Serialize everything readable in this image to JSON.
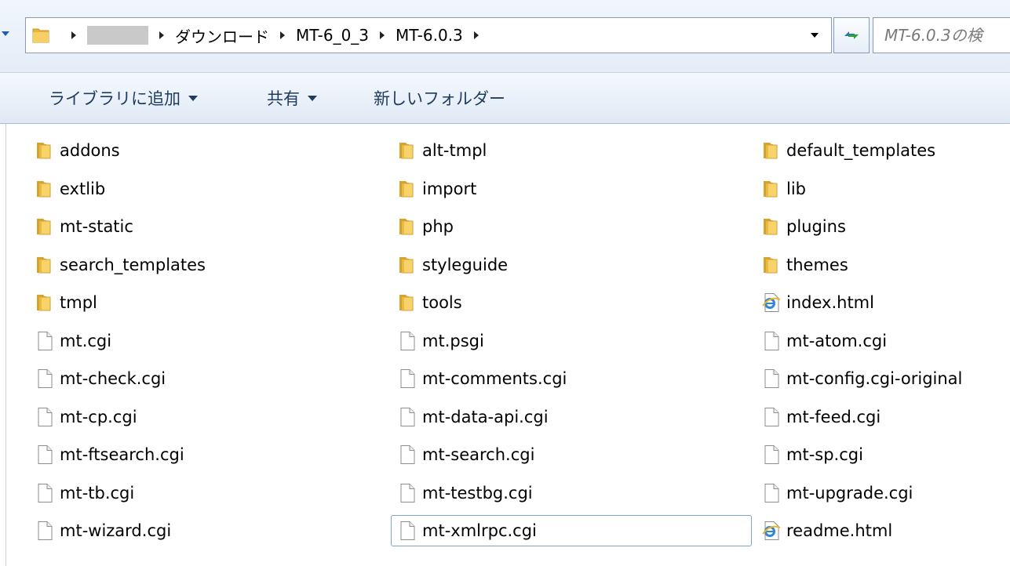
{
  "window": {
    "address": {
      "crumbs": [
        "ダウンロード",
        "MT-6_0_3",
        "MT-6.0.3"
      ],
      "search_placeholder": "MT-6.0.3の検"
    },
    "toolbar": {
      "add_to_library": "ライブラリに追加",
      "share": "共有",
      "new_folder": "新しいフォルダー"
    }
  },
  "colors": {
    "folder": "#f2c443",
    "toolbar_text": "#1e3a5f",
    "selection_border": "#7da2ce"
  },
  "items": [
    {
      "name": "addons",
      "type": "folder"
    },
    {
      "name": "alt-tmpl",
      "type": "folder"
    },
    {
      "name": "default_templates",
      "type": "folder"
    },
    {
      "name": "extlib",
      "type": "folder"
    },
    {
      "name": "import",
      "type": "folder"
    },
    {
      "name": "lib",
      "type": "folder"
    },
    {
      "name": "mt-static",
      "type": "folder"
    },
    {
      "name": "php",
      "type": "folder"
    },
    {
      "name": "plugins",
      "type": "folder"
    },
    {
      "name": "search_templates",
      "type": "folder"
    },
    {
      "name": "styleguide",
      "type": "folder"
    },
    {
      "name": "themes",
      "type": "folder"
    },
    {
      "name": "tmpl",
      "type": "folder"
    },
    {
      "name": "tools",
      "type": "folder"
    },
    {
      "name": "index.html",
      "type": "html"
    },
    {
      "name": "mt.cgi",
      "type": "file"
    },
    {
      "name": "mt.psgi",
      "type": "file"
    },
    {
      "name": "mt-atom.cgi",
      "type": "file"
    },
    {
      "name": "mt-check.cgi",
      "type": "file"
    },
    {
      "name": "mt-comments.cgi",
      "type": "file"
    },
    {
      "name": "mt-config.cgi-original",
      "type": "file"
    },
    {
      "name": "mt-cp.cgi",
      "type": "file"
    },
    {
      "name": "mt-data-api.cgi",
      "type": "file"
    },
    {
      "name": "mt-feed.cgi",
      "type": "file"
    },
    {
      "name": "mt-ftsearch.cgi",
      "type": "file"
    },
    {
      "name": "mt-search.cgi",
      "type": "file"
    },
    {
      "name": "mt-sp.cgi",
      "type": "file"
    },
    {
      "name": "mt-tb.cgi",
      "type": "file"
    },
    {
      "name": "mt-testbg.cgi",
      "type": "file"
    },
    {
      "name": "mt-upgrade.cgi",
      "type": "file"
    },
    {
      "name": "mt-wizard.cgi",
      "type": "file"
    },
    {
      "name": "mt-xmlrpc.cgi",
      "type": "file",
      "selected": true
    },
    {
      "name": "readme.html",
      "type": "html"
    }
  ]
}
